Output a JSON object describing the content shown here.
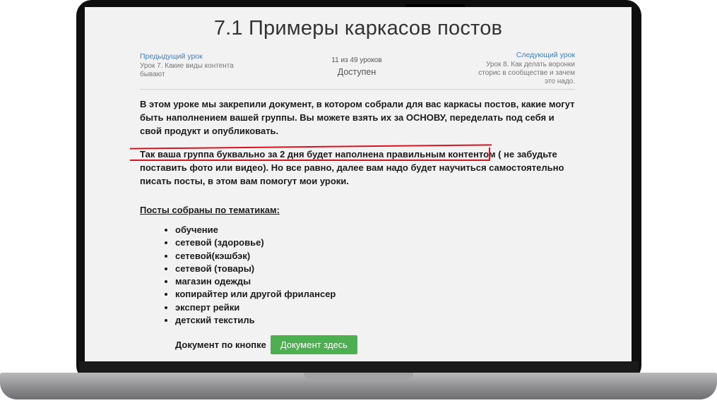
{
  "lesson": {
    "title": "7.1 Примеры каркасов постов",
    "prev": {
      "head": "Предыдущий урок",
      "name": "Урок 7. Какие виды контента бывают"
    },
    "progress": {
      "count": "11 из 49 уроков",
      "status": "Доступен"
    },
    "next": {
      "head": "Следующий урок",
      "name": "Урок 8. Как делать воронки сторис в сообществе и зачем это надо."
    }
  },
  "body": {
    "paragraph1": "В этом уроке мы закрепили документ, в котором собрали для вас каркасы постов, какие могут быть наполнением вашей группы. Вы можете взять их за ОСНОВУ, переделать под себя и свой продукт и опубликовать.",
    "paragraph2": "Так ваша группа буквально за 2 дня будет наполнена правильным контентом ( не забудьте поставить фото или видео).  Но все равно,  далее вам надо будет научиться самостоятельно писать посты, в этом вам помогут мои уроки.",
    "topics_title": "Посты собраны по тематикам:",
    "topics": [
      "обучение",
      "сетевой (здоровье)",
      "сетевой(кэшбэк)",
      "сетевой (товары)",
      "магазин одежды",
      "копирайтер или другой фрилансер",
      "эксперт рейки",
      "детский текстиль"
    ],
    "doc_label": "Документ по кнопке",
    "doc_button": "Документ здесь"
  },
  "colors": {
    "accent_link": "#3f7fbf",
    "button_green": "#4caf50",
    "highlight_red": "#d8151f"
  }
}
